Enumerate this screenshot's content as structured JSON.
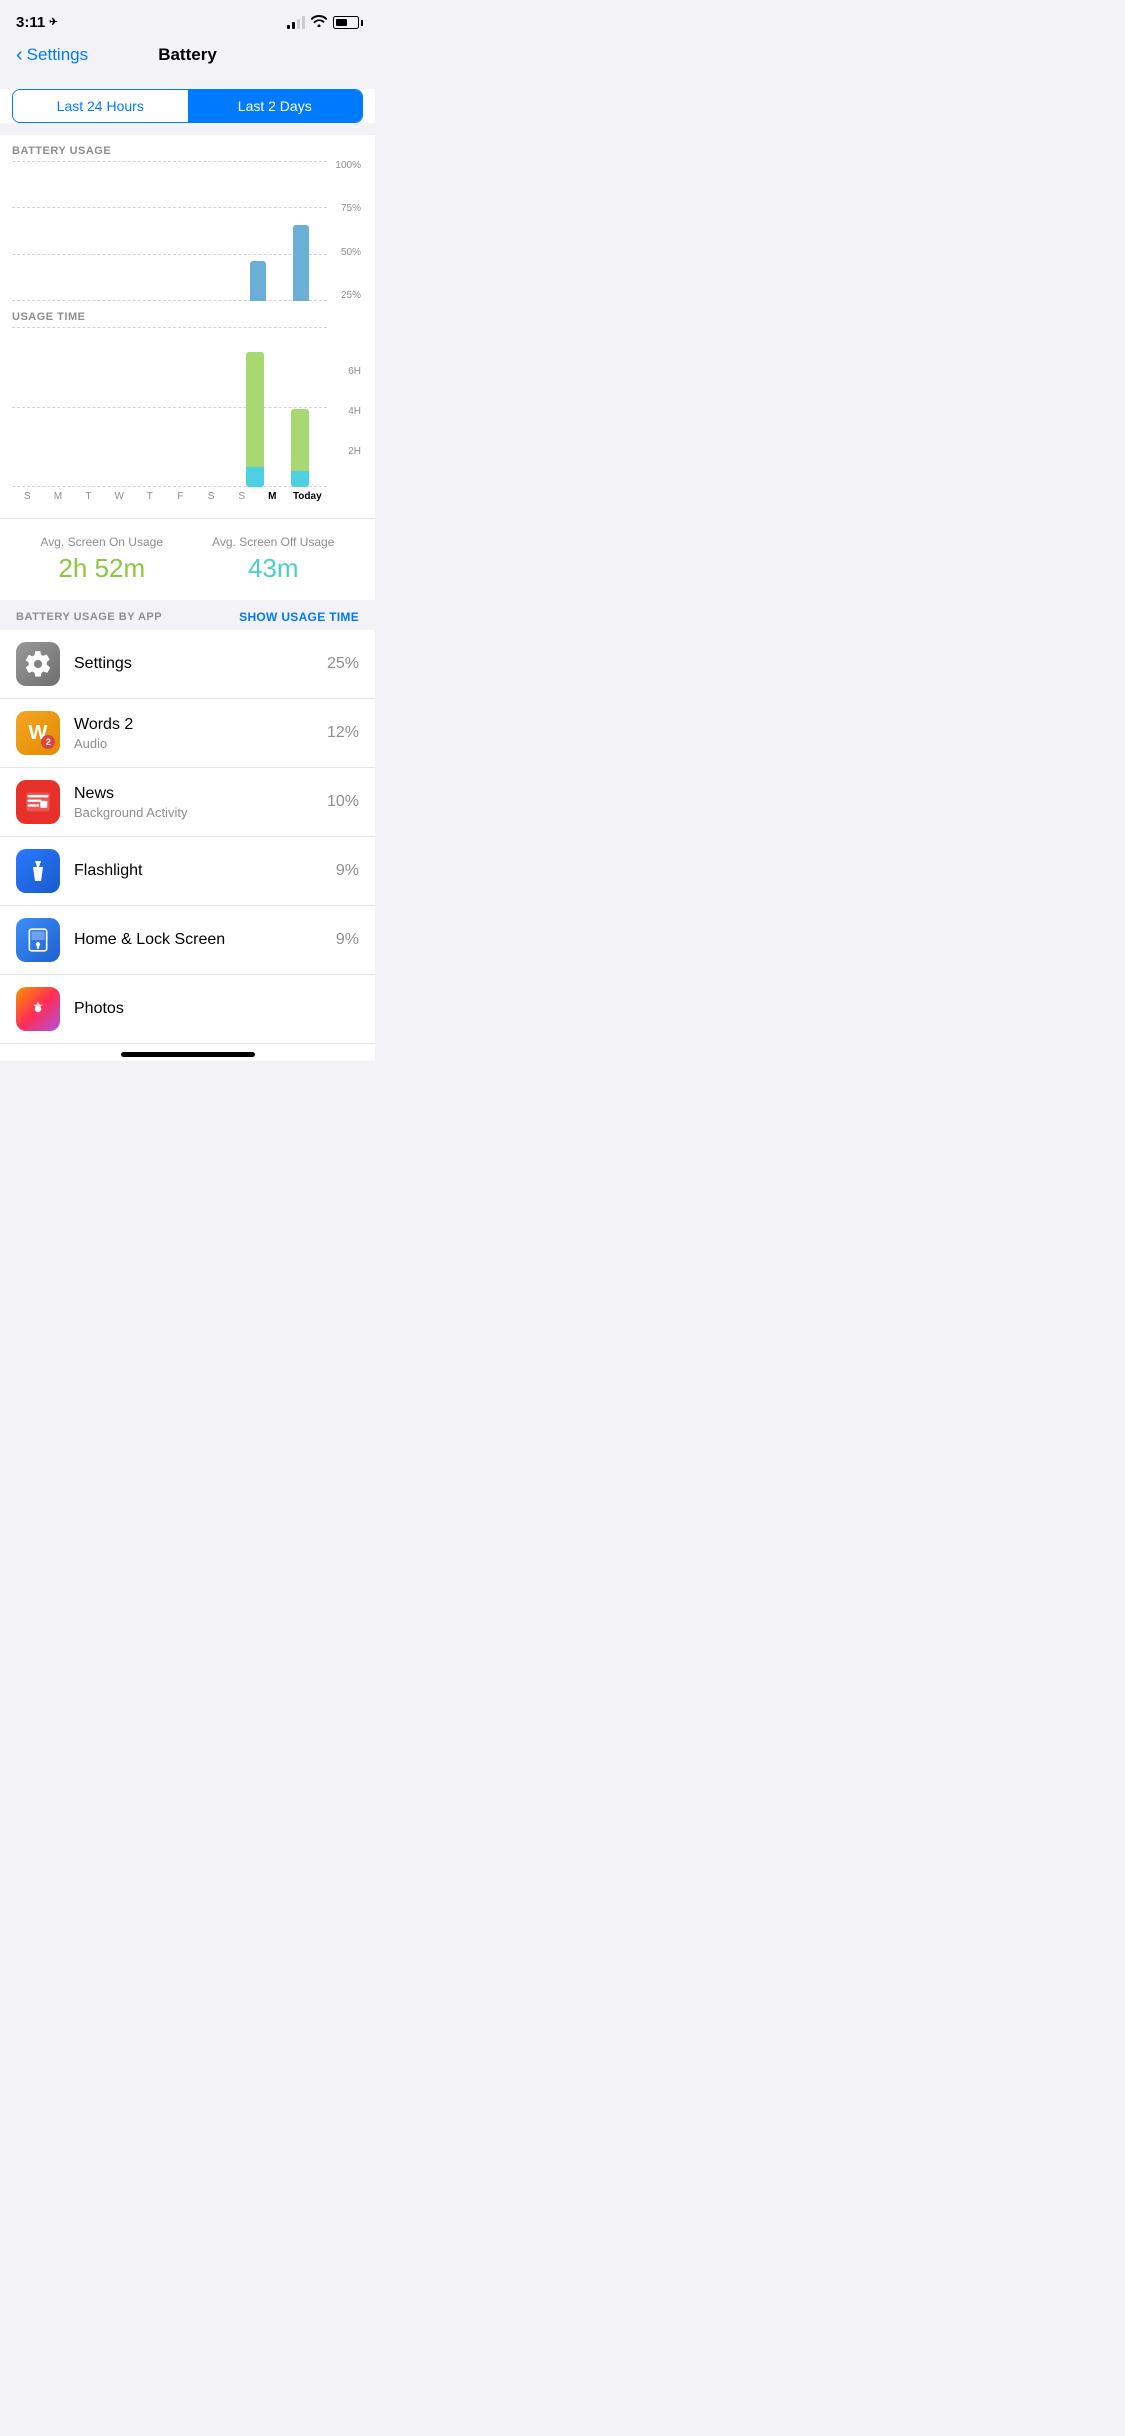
{
  "statusBar": {
    "time": "3:11",
    "locationIcon": "▲"
  },
  "nav": {
    "backLabel": "Settings",
    "title": "Battery"
  },
  "segmentControl": {
    "option1": "Last 24 Hours",
    "option2": "Last 2 Days",
    "activeIndex": 1
  },
  "batteryChart": {
    "sectionLabel": "BATTERY USAGE",
    "yLabels": [
      "100%",
      "75%",
      "50%",
      "25%"
    ],
    "bars": [
      {
        "day": "S",
        "height": 0
      },
      {
        "day": "M",
        "height": 0
      },
      {
        "day": "T",
        "height": 0
      },
      {
        "day": "W",
        "height": 0
      },
      {
        "day": "T",
        "height": 0
      },
      {
        "day": "F",
        "height": 0
      },
      {
        "day": "S",
        "height": 0
      },
      {
        "day": "S",
        "height": 0
      },
      {
        "day": "M",
        "height": 30
      },
      {
        "day": "Today",
        "height": 60
      }
    ]
  },
  "usageChart": {
    "sectionLabel": "USAGE TIME",
    "yLabels": [
      "6H",
      "4H",
      "2H"
    ],
    "bars": [
      {
        "day": "S",
        "on": 0,
        "off": 0
      },
      {
        "day": "M",
        "on": 0,
        "off": 0
      },
      {
        "day": "T",
        "on": 0,
        "off": 0
      },
      {
        "day": "W",
        "on": 0,
        "off": 0
      },
      {
        "day": "T",
        "on": 0,
        "off": 0
      },
      {
        "day": "F",
        "on": 0,
        "off": 0
      },
      {
        "day": "S",
        "on": 0,
        "off": 0
      },
      {
        "day": "S",
        "on": 0,
        "off": 0
      },
      {
        "day": "M",
        "on": 85,
        "off": 14
      },
      {
        "day": "Today",
        "on": 45,
        "off": 12
      }
    ]
  },
  "xLabels": [
    "S",
    "M",
    "T",
    "W",
    "T",
    "F",
    "S",
    "S",
    "M",
    "Today"
  ],
  "stats": {
    "screenOnLabel": "Avg. Screen On Usage",
    "screenOnValue": "2h 52m",
    "screenOffLabel": "Avg. Screen Off Usage",
    "screenOffValue": "43m"
  },
  "appSection": {
    "label": "BATTERY USAGE BY APP",
    "showUsageBtn": "SHOW USAGE TIME"
  },
  "apps": [
    {
      "name": "Settings",
      "sub": "",
      "percent": "25%",
      "icon": "settings"
    },
    {
      "name": "Words 2",
      "sub": "Audio",
      "percent": "12%",
      "icon": "words2"
    },
    {
      "name": "News",
      "sub": "Background Activity",
      "percent": "10%",
      "icon": "news"
    },
    {
      "name": "Flashlight",
      "sub": "",
      "percent": "9%",
      "icon": "flashlight"
    },
    {
      "name": "Home & Lock Screen",
      "sub": "",
      "percent": "9%",
      "icon": "homelock"
    },
    {
      "name": "Photos",
      "sub": "",
      "percent": "",
      "icon": "photos"
    }
  ]
}
